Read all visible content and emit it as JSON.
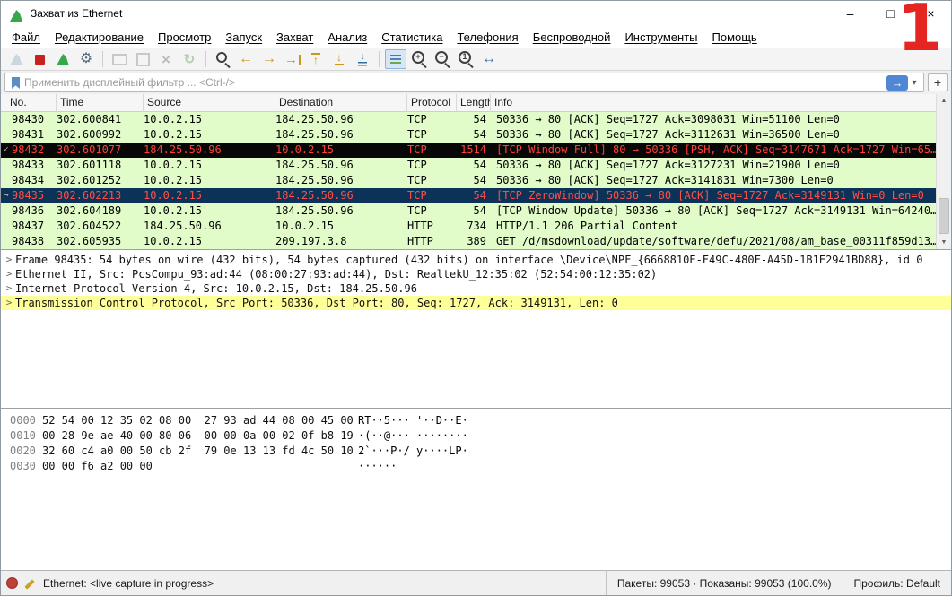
{
  "window": {
    "title": "Захват из Ethernet",
    "controls": {
      "minimize": "–",
      "maximize": "□",
      "close": "×"
    },
    "overlay_digit": "1"
  },
  "colors": {
    "row_green": "#e1fcc8",
    "bad_bg": "#070707",
    "bad_fg": "#ff4136",
    "selected_bg": "#0c3257",
    "selected_fg": "#ff5048",
    "detail_highlight": "#ffff99",
    "accent_blue": "#4f87d4",
    "stop_red": "#c9211e",
    "capture_green": "#35a849",
    "overlay_red": "#e52620"
  },
  "menu": {
    "items": [
      {
        "id": "file",
        "label": "Файл"
      },
      {
        "id": "edit",
        "label": "Редактирование"
      },
      {
        "id": "view",
        "label": "Просмотр"
      },
      {
        "id": "go",
        "label": "Запуск"
      },
      {
        "id": "capture",
        "label": "Захват"
      },
      {
        "id": "analyze",
        "label": "Анализ"
      },
      {
        "id": "statistics",
        "label": "Статистика"
      },
      {
        "id": "telephony",
        "label": "Телефония"
      },
      {
        "id": "wireless",
        "label": "Беспроводной"
      },
      {
        "id": "tools",
        "label": "Инструменты"
      },
      {
        "id": "help",
        "label": "Помощь"
      }
    ]
  },
  "toolbar": {
    "items": [
      {
        "name": "start-capture-button",
        "icon": "fin",
        "color": "#8aa9bd",
        "enabled": false
      },
      {
        "name": "stop-capture-button",
        "icon": "stop",
        "color": "#c9211e",
        "enabled": true
      },
      {
        "name": "restart-capture-button",
        "icon": "fin",
        "color": "#35a849",
        "enabled": true
      },
      {
        "name": "capture-options-button",
        "icon": "gear",
        "color": "#53677a",
        "enabled": true
      },
      {
        "sep": true
      },
      {
        "name": "open-file-button",
        "icon": "folder",
        "color": "#808080",
        "enabled": false
      },
      {
        "name": "save-file-button",
        "icon": "save",
        "color": "#808080",
        "enabled": false
      },
      {
        "name": "close-file-button",
        "icon": "close",
        "color": "#606060",
        "enabled": false
      },
      {
        "name": "reload-file-button",
        "icon": "reload",
        "color": "#4c8c4a",
        "enabled": false
      },
      {
        "sep": true
      },
      {
        "name": "find-packet-button",
        "icon": "search",
        "color": "#3f3f3f",
        "enabled": true
      },
      {
        "name": "go-back-button",
        "icon": "arrow-left",
        "color": "#c79a1e",
        "enabled": true
      },
      {
        "name": "go-forward-button",
        "icon": "arrow-right",
        "color": "#c79a1e",
        "enabled": true
      },
      {
        "name": "go-to-packet-button",
        "icon": "goto",
        "color": "#c79a1e",
        "enabled": true
      },
      {
        "name": "go-first-button",
        "icon": "arrow-top",
        "color": "#c79a1e",
        "enabled": true
      },
      {
        "name": "go-last-button",
        "icon": "arrow-bottom",
        "color": "#c79a1e",
        "enabled": true
      },
      {
        "name": "autoscroll-button",
        "icon": "autoscroll",
        "color": "#2e6da4",
        "enabled": true
      },
      {
        "sep": true
      },
      {
        "name": "colorize-button",
        "icon": "colorize",
        "color": "#4f81bd",
        "enabled": true,
        "active": true
      },
      {
        "name": "zoom-in-button",
        "icon": "zoom-in",
        "color": "#3f3f3f",
        "enabled": true
      },
      {
        "name": "zoom-out-button",
        "icon": "zoom-out",
        "color": "#3f3f3f",
        "enabled": true
      },
      {
        "name": "zoom-reset-button",
        "icon": "zoom-reset",
        "color": "#3f3f3f",
        "enabled": true
      },
      {
        "name": "resize-columns-button",
        "icon": "resize",
        "color": "#3f6fa8",
        "enabled": true
      }
    ]
  },
  "filter": {
    "placeholder": "Применить дисплейный фильтр ... <Ctrl-/>",
    "apply_glyph": "→",
    "dropdown_glyph": "▾",
    "add_glyph": "+"
  },
  "packet_list": {
    "columns": [
      "No.",
      "Time",
      "Source",
      "Destination",
      "Protocol",
      "Length",
      "Info"
    ],
    "rows": [
      {
        "no": "98430",
        "time": "302.600841",
        "source": "10.0.2.15",
        "destination": "184.25.50.96",
        "protocol": "TCP",
        "length": "54",
        "info": "50336 → 80 [ACK] Seq=1727 Ack=3098031 Win=51100 Len=0",
        "state": "green",
        "marker": ""
      },
      {
        "no": "98431",
        "time": "302.600992",
        "source": "10.0.2.15",
        "destination": "184.25.50.96",
        "protocol": "TCP",
        "length": "54",
        "info": "50336 → 80 [ACK] Seq=1727 Ack=3112631 Win=36500 Len=0",
        "state": "green",
        "marker": ""
      },
      {
        "no": "98432",
        "time": "302.601077",
        "source": "184.25.50.96",
        "destination": "10.0.2.15",
        "protocol": "TCP",
        "length": "1514",
        "info": "[TCP Window Full] 80 → 50336 [PSH, ACK] Seq=3147671 Ack=1727 Win=65…",
        "state": "bad",
        "marker": "✓"
      },
      {
        "no": "98433",
        "time": "302.601118",
        "source": "10.0.2.15",
        "destination": "184.25.50.96",
        "protocol": "TCP",
        "length": "54",
        "info": "50336 → 80 [ACK] Seq=1727 Ack=3127231 Win=21900 Len=0",
        "state": "green",
        "marker": ""
      },
      {
        "no": "98434",
        "time": "302.601252",
        "source": "10.0.2.15",
        "destination": "184.25.50.96",
        "protocol": "TCP",
        "length": "54",
        "info": "50336 → 80 [ACK] Seq=1727 Ack=3141831 Win=7300 Len=0",
        "state": "green",
        "marker": ""
      },
      {
        "no": "98435",
        "time": "302.602213",
        "source": "10.0.2.15",
        "destination": "184.25.50.96",
        "protocol": "TCP",
        "length": "54",
        "info": "[TCP ZeroWindow] 50336 → 80 [ACK] Seq=1727 Ack=3149131 Win=0 Len=0",
        "state": "selected",
        "marker": "→"
      },
      {
        "no": "98436",
        "time": "302.604189",
        "source": "10.0.2.15",
        "destination": "184.25.50.96",
        "protocol": "TCP",
        "length": "54",
        "info": "[TCP Window Update] 50336 → 80 [ACK] Seq=1727 Ack=3149131 Win=64240…",
        "state": "green",
        "marker": ""
      },
      {
        "no": "98437",
        "time": "302.604522",
        "source": "184.25.50.96",
        "destination": "10.0.2.15",
        "protocol": "HTTP",
        "length": "734",
        "info": "HTTP/1.1 206 Partial Content",
        "state": "green",
        "marker": ""
      },
      {
        "no": "98438",
        "time": "302.605935",
        "source": "10.0.2.15",
        "destination": "209.197.3.8",
        "protocol": "HTTP",
        "length": "389",
        "info": "GET /d/msdownload/update/software/defu/2021/08/am_base_00311f859d13…",
        "state": "green",
        "marker": ""
      }
    ]
  },
  "details": {
    "expander_glyph": ">",
    "lines": [
      {
        "text": "Frame 98435: 54 bytes on wire (432 bits), 54 bytes captured (432 bits) on interface \\Device\\NPF_{6668810E-F49C-480F-A45D-1B1E2941BD88}, id 0",
        "selected": false
      },
      {
        "text": "Ethernet II, Src: PcsCompu_93:ad:44 (08:00:27:93:ad:44), Dst: RealtekU_12:35:02 (52:54:00:12:35:02)",
        "selected": false
      },
      {
        "text": "Internet Protocol Version 4, Src: 10.0.2.15, Dst: 184.25.50.96",
        "selected": false
      },
      {
        "text": "Transmission Control Protocol, Src Port: 50336, Dst Port: 80, Seq: 1727, Ack: 3149131, Len: 0",
        "selected": true
      }
    ]
  },
  "hex": {
    "rows": [
      {
        "offset": "0000",
        "bytes": "52 54 00 12 35 02 08 00  27 93 ad 44 08 00 45 00",
        "ascii": "RT··5··· '··D··E·"
      },
      {
        "offset": "0010",
        "bytes": "00 28 9e ae 40 00 80 06  00 00 0a 00 02 0f b8 19",
        "ascii": "·(··@··· ········"
      },
      {
        "offset": "0020",
        "bytes": "32 60 c4 a0 00 50 cb 2f  79 0e 13 13 fd 4c 50 10",
        "ascii": "2`···P·/ y····LP·"
      },
      {
        "offset": "0030",
        "bytes": "00 00 f6 a2 00 00",
        "ascii": "······"
      }
    ]
  },
  "status": {
    "left": "Ethernet: <live capture in progress>",
    "packets": "Пакеты: 99053 · Показаны: 99053 (100.0%)",
    "profile": "Профиль: Default"
  }
}
